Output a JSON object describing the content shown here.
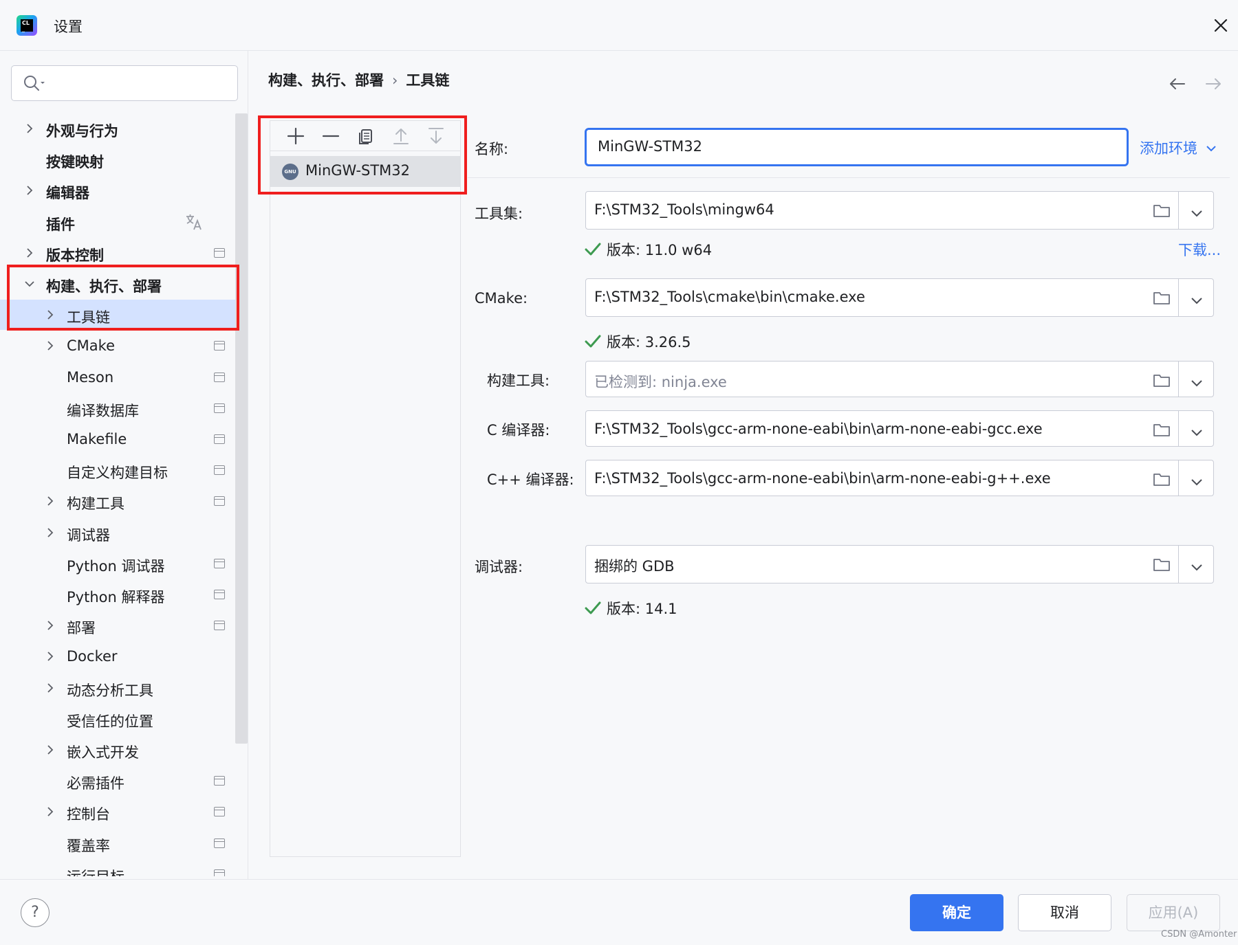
{
  "window": {
    "title": "设置"
  },
  "search": {
    "placeholder": ""
  },
  "sidebar": {
    "items": [
      {
        "label": "外观与行为",
        "bold": true,
        "expandable": true,
        "expanded": false,
        "indent": 0,
        "scope_icon": false
      },
      {
        "label": "按键映射",
        "bold": true,
        "expandable": false,
        "indent": 0,
        "scope_icon": false
      },
      {
        "label": "编辑器",
        "bold": true,
        "expandable": true,
        "expanded": false,
        "indent": 0,
        "scope_icon": false
      },
      {
        "label": "插件",
        "bold": true,
        "expandable": false,
        "indent": 0,
        "scope_icon": false,
        "translate_icon": true
      },
      {
        "label": "版本控制",
        "bold": true,
        "expandable": true,
        "expanded": false,
        "indent": 0,
        "scope_icon": true
      },
      {
        "label": "构建、执行、部署",
        "bold": true,
        "expandable": true,
        "expanded": true,
        "indent": 0,
        "scope_icon": false
      },
      {
        "label": "工具链",
        "bold": false,
        "expandable": true,
        "expanded": false,
        "indent": 1,
        "scope_icon": false,
        "selected": true
      },
      {
        "label": "CMake",
        "bold": false,
        "expandable": true,
        "expanded": false,
        "indent": 1,
        "scope_icon": true
      },
      {
        "label": "Meson",
        "bold": false,
        "expandable": false,
        "indent": 1,
        "scope_icon": true
      },
      {
        "label": "编译数据库",
        "bold": false,
        "expandable": false,
        "indent": 1,
        "scope_icon": true
      },
      {
        "label": "Makefile",
        "bold": false,
        "expandable": false,
        "indent": 1,
        "scope_icon": true
      },
      {
        "label": "自定义构建目标",
        "bold": false,
        "expandable": false,
        "indent": 1,
        "scope_icon": true
      },
      {
        "label": "构建工具",
        "bold": false,
        "expandable": true,
        "expanded": false,
        "indent": 1,
        "scope_icon": true
      },
      {
        "label": "调试器",
        "bold": false,
        "expandable": true,
        "expanded": false,
        "indent": 1,
        "scope_icon": false
      },
      {
        "label": "Python 调试器",
        "bold": false,
        "expandable": false,
        "indent": 1,
        "scope_icon": true
      },
      {
        "label": "Python 解释器",
        "bold": false,
        "expandable": false,
        "indent": 1,
        "scope_icon": true
      },
      {
        "label": "部署",
        "bold": false,
        "expandable": true,
        "expanded": false,
        "indent": 1,
        "scope_icon": true
      },
      {
        "label": "Docker",
        "bold": false,
        "expandable": true,
        "expanded": false,
        "indent": 1,
        "scope_icon": false
      },
      {
        "label": "动态分析工具",
        "bold": false,
        "expandable": true,
        "expanded": false,
        "indent": 1,
        "scope_icon": false
      },
      {
        "label": "受信任的位置",
        "bold": false,
        "expandable": false,
        "indent": 1,
        "scope_icon": false
      },
      {
        "label": "嵌入式开发",
        "bold": false,
        "expandable": true,
        "expanded": false,
        "indent": 1,
        "scope_icon": false
      },
      {
        "label": "必需插件",
        "bold": false,
        "expandable": false,
        "indent": 1,
        "scope_icon": true
      },
      {
        "label": "控制台",
        "bold": false,
        "expandable": true,
        "expanded": false,
        "indent": 1,
        "scope_icon": true
      },
      {
        "label": "覆盖率",
        "bold": false,
        "expandable": false,
        "indent": 1,
        "scope_icon": true
      },
      {
        "label": "运行目标",
        "bold": false,
        "expandable": false,
        "indent": 1,
        "scope_icon": true
      }
    ]
  },
  "breadcrumb": {
    "parent": "构建、执行、部署",
    "separator": "›",
    "current": "工具链"
  },
  "toolchains": {
    "toolbar_icons": [
      "add-icon",
      "remove-icon",
      "copy-icon",
      "move-up-icon",
      "move-down-icon"
    ],
    "items": [
      {
        "label": "MinGW-STM32",
        "icon": "gnu-icon",
        "selected": true
      }
    ]
  },
  "form": {
    "name": {
      "label": "名称:",
      "value": "MinGW-STM32"
    },
    "add_env_label": "添加环境",
    "toolset": {
      "label": "工具集:",
      "value": "F:\\STM32_Tools\\mingw64",
      "version": "版本: 11.0 w64",
      "download": "下载..."
    },
    "cmake": {
      "label": "CMake:",
      "value": "F:\\STM32_Tools\\cmake\\bin\\cmake.exe",
      "version": "版本: 3.26.5"
    },
    "build_tool": {
      "label": "构建工具:",
      "placeholder": "已检测到: ninja.exe"
    },
    "c_compiler": {
      "label": "C 编译器:",
      "value": "F:\\STM32_Tools\\gcc-arm-none-eabi\\bin\\arm-none-eabi-gcc.exe"
    },
    "cpp_compiler": {
      "label": "C++ 编译器:",
      "value": "F:\\STM32_Tools\\gcc-arm-none-eabi\\bin\\arm-none-eabi-g++.exe"
    },
    "debugger": {
      "label": "调试器:",
      "value": "捆绑的 GDB",
      "version": "版本: 14.1"
    }
  },
  "footer": {
    "help": "?",
    "ok": "确定",
    "cancel": "取消",
    "apply": "应用(A)"
  },
  "watermark": "CSDN @Amonter",
  "colors": {
    "accent": "#3574f0",
    "highlight": "#ef1e1e",
    "selected_row": "#d4e2ff",
    "check": "#3d9a50"
  }
}
